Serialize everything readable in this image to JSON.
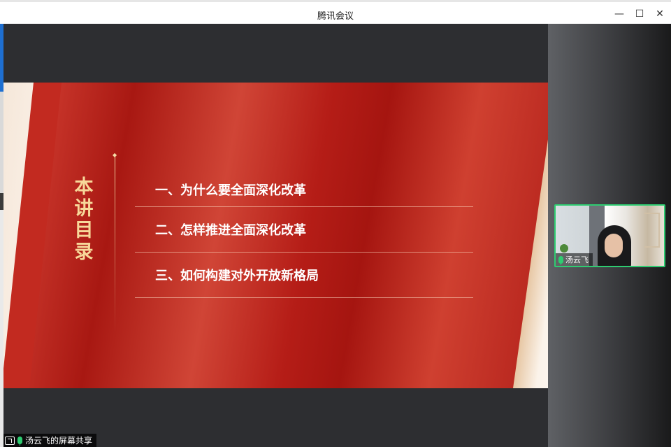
{
  "window": {
    "title": "腾讯会议",
    "minimize_glyph": "—",
    "maximize_glyph": "☐",
    "close_glyph": "✕"
  },
  "slide": {
    "vertical_title": [
      "本",
      "讲",
      "目",
      "录"
    ],
    "menu": [
      {
        "label": "一、为什么要全面深化改革"
      },
      {
        "label": "二、怎样推进全面深化改革"
      },
      {
        "label": "三、如何构建对外开放新格局"
      }
    ],
    "colors": {
      "primary_red": "#b32019",
      "gold": "#f7d89a"
    }
  },
  "video_tile": {
    "participant_name": "汤云飞",
    "mic_icon": "mic-icon",
    "border_color": "#2ecc71"
  },
  "status": {
    "share_icon": "screen-share-icon",
    "text": "汤云飞的屏幕共享"
  }
}
